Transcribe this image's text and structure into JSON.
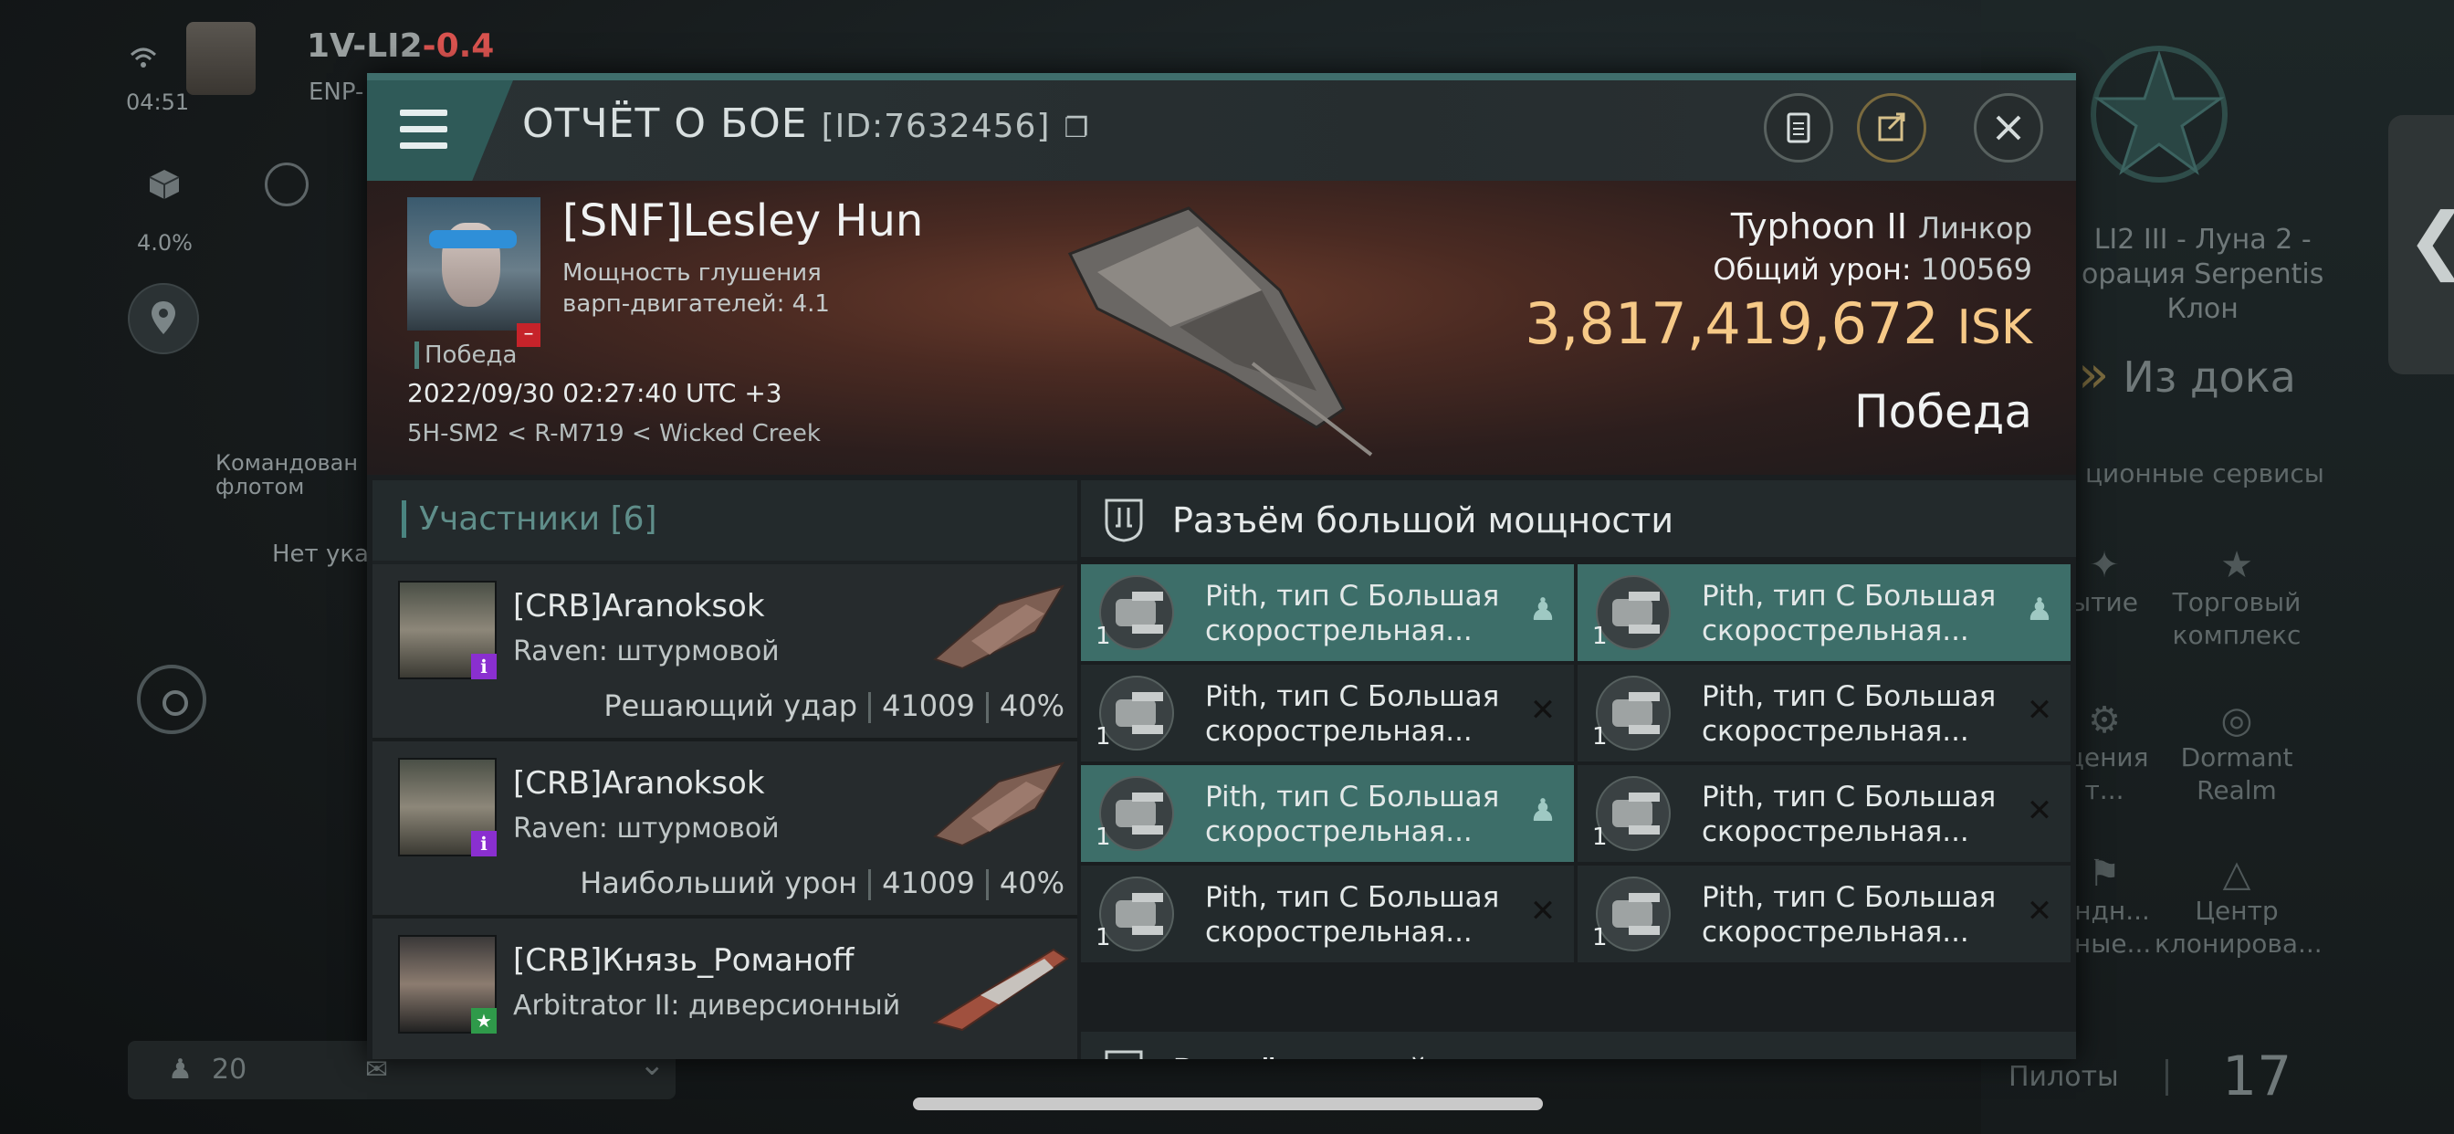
{
  "status_bar": {
    "time": "04:51"
  },
  "hud": {
    "system_name": "1V-LI2",
    "security": "-0.4",
    "constellation_partial": "ENP-",
    "cargo_percent": "4.0%",
    "fleet_label": "Командован\nфлотом",
    "fleet_value": "Нет ука",
    "station_name": "LI2 III - Луна 2 -\nорация Serpentis\nКлон",
    "undock_label": "Из дока",
    "services_label": "ционные сервисы",
    "services": [
      {
        "label": "ытие",
        "icon": "sparkle-icon"
      },
      {
        "label": "Торговый\nкомплекс",
        "icon": "nes-icon"
      },
      {
        "label": "щения\nт...",
        "icon": "fitting-icon"
      },
      {
        "label": "Dormant\nRealm",
        "icon": "realm-icon"
      },
      {
        "label": "андн...\nиные...",
        "icon": "flag-icon"
      },
      {
        "label": "Центр\nклонирова...",
        "icon": "clone-icon"
      }
    ],
    "local_count": "20",
    "pilots_label": "Пилоты",
    "pilots_count": "17"
  },
  "report": {
    "title": "ОТЧЁТ О БОЕ",
    "id": "[ID:7632456]",
    "victim": {
      "name": "[SNF]Lesley Hun",
      "warp_line1": "Мощность глушения",
      "warp_line2": "варп-двигателей: 4.1",
      "victory_tag": "Победа",
      "datetime": "2022/09/30 02:27:40 UTC +3",
      "location": "5H-SM2 < R-M719 < Wicked Creek",
      "ship_name": "Typhoon II",
      "ship_class": "Линкор",
      "damage_label": "Общий урон:",
      "damage_value": "100569",
      "isk_value": "3,817,419,672",
      "isk_unit": "ISK",
      "result": "Победа"
    },
    "participants": {
      "title": "Участники [6]",
      "rows": [
        {
          "name": "[CRB]Aranoksok",
          "ship": "Raven: штурмовой",
          "role": "Решающий удар",
          "damage": "41009",
          "percent": "40%"
        },
        {
          "name": "[CRB]Aranoksok",
          "ship": "Raven: штурмовой",
          "role": "Наибольший урон",
          "damage": "41009",
          "percent": "40%"
        },
        {
          "name": "[CRB]Князь_Романoff",
          "ship": "Arbitrator II: диверсионный",
          "role": "",
          "damage": "",
          "percent": ""
        }
      ]
    },
    "high_slots": {
      "title": "Разъём большой мощности",
      "modules": [
        {
          "line1": "Pith, тип C Большая",
          "line2": "скорострельная...",
          "qty": "1",
          "status": "person-icon",
          "active": true
        },
        {
          "line1": "Pith, тип C Большая",
          "line2": "скорострельная...",
          "qty": "1",
          "status": "person-icon",
          "active": true
        },
        {
          "line1": "Pith, тип C Большая",
          "line2": "скорострельная...",
          "qty": "1",
          "status": "destroyed-icon",
          "active": false
        },
        {
          "line1": "Pith, тип C Большая",
          "line2": "скорострельная...",
          "qty": "1",
          "status": "destroyed-icon",
          "active": false
        },
        {
          "line1": "Pith, тип C Большая",
          "line2": "скорострельная...",
          "qty": "1",
          "status": "person-icon",
          "active": true
        },
        {
          "line1": "Pith, тип C Большая",
          "line2": "скорострельная...",
          "qty": "1",
          "status": "destroyed-icon",
          "active": false
        },
        {
          "line1": "Pith, тип C Большая",
          "line2": "скорострельная...",
          "qty": "1",
          "status": "destroyed-icon",
          "active": false
        },
        {
          "line1": "Pith, тип C Большая",
          "line2": "скорострельная...",
          "qty": "1",
          "status": "destroyed-icon",
          "active": false
        }
      ]
    },
    "mid_slots": {
      "title": "Разъём малой мощности"
    }
  },
  "colors": {
    "accent": "#3d6e69",
    "isk": "#f6c987",
    "security": "#d9534f"
  }
}
